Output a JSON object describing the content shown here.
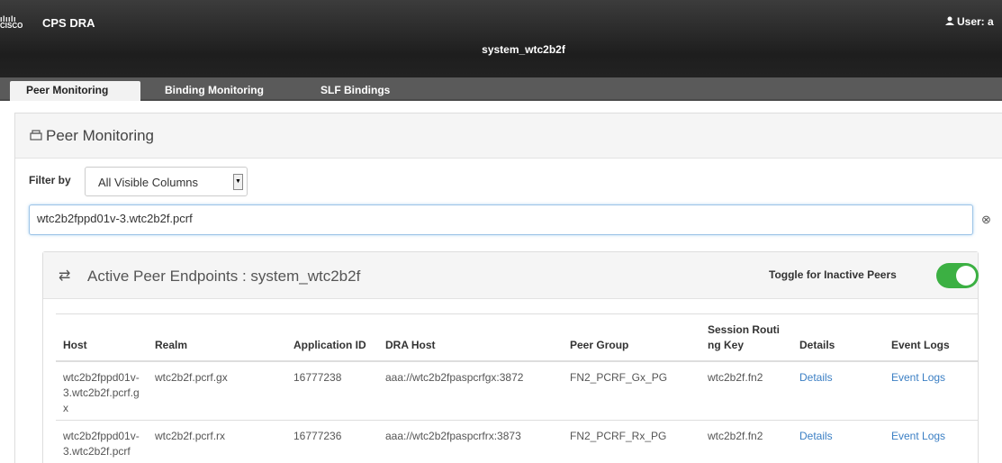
{
  "header": {
    "logo_bars": "ılıılı",
    "logo_word": "CISCO",
    "app_title": "CPS DRA",
    "user_label": "User: a",
    "system_title": "system_wtc2b2f"
  },
  "tabs": [
    {
      "label": "Peer Monitoring",
      "active": true
    },
    {
      "label": "Binding Monitoring",
      "active": false
    },
    {
      "label": "SLF Bindings",
      "active": false
    }
  ],
  "panel": {
    "title": "Peer Monitoring",
    "filter_label": "Filter by",
    "filter_value": "All Visible Columns",
    "search_value": "wtc2b2fppd01v-3.wtc2b2f.pcrf"
  },
  "subpanel": {
    "title": "Active Peer Endpoints : system_wtc2b2f",
    "toggle_label": "Toggle for Inactive Peers",
    "toggle_on": true
  },
  "table": {
    "headers": {
      "host": "Host",
      "realm": "Realm",
      "app_id": "Application ID",
      "dra_host": "DRA Host",
      "peer_group": "Peer Group",
      "session_key": "Session Routing Key",
      "details": "Details",
      "event_logs": "Event Logs"
    },
    "rows": [
      {
        "host": "wtc2b2fppd01v-3.wtc2b2f.pcrf.gx",
        "realm": "wtc2b2f.pcrf.gx",
        "app_id": "16777238",
        "dra_host": "aaa://wtc2b2fpaspcrfgx:3872",
        "peer_group": "FN2_PCRF_Gx_PG",
        "session_key": "wtc2b2f.fn2",
        "details": "Details",
        "event_logs": "Event Logs"
      },
      {
        "host": "wtc2b2fppd01v-3.wtc2b2f.pcrf",
        "realm": "wtc2b2f.pcrf.rx",
        "app_id": "16777236",
        "dra_host": "aaa://wtc2b2fpaspcrfrx:3873",
        "peer_group": "FN2_PCRF_Rx_PG",
        "session_key": "wtc2b2f.fn2",
        "details": "Details",
        "event_logs": "Event Logs"
      }
    ]
  },
  "colors": {
    "topbar": "#2a2a2a",
    "tabbar": "#5a5a5a",
    "toggle_on": "#3cb043",
    "link": "#3b7fc4"
  },
  "icons": {
    "user": "user-icon",
    "panel": "printer-icon",
    "subpanel": "exchange-arrows-icon",
    "clear": "clear-circle-icon"
  }
}
